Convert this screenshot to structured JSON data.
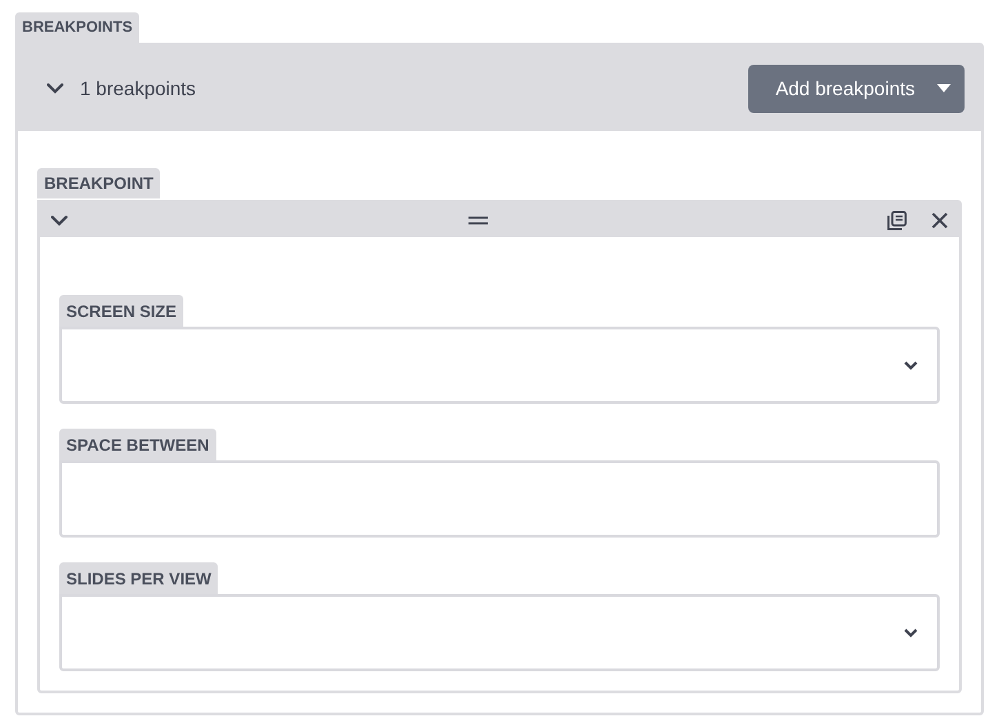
{
  "section": {
    "title": "BREAKPOINTS",
    "expanded": true,
    "count_label": "1 breakpoints",
    "add_button": "Add breakpoints"
  },
  "items": [
    {
      "title": "BREAKPOINT",
      "expanded": true,
      "fields": [
        {
          "label": "SCREEN SIZE",
          "kind": "select"
        },
        {
          "label": "SPACE BETWEEN",
          "kind": "text"
        },
        {
          "label": "SLIDES PER VIEW",
          "kind": "select"
        }
      ]
    }
  ]
}
